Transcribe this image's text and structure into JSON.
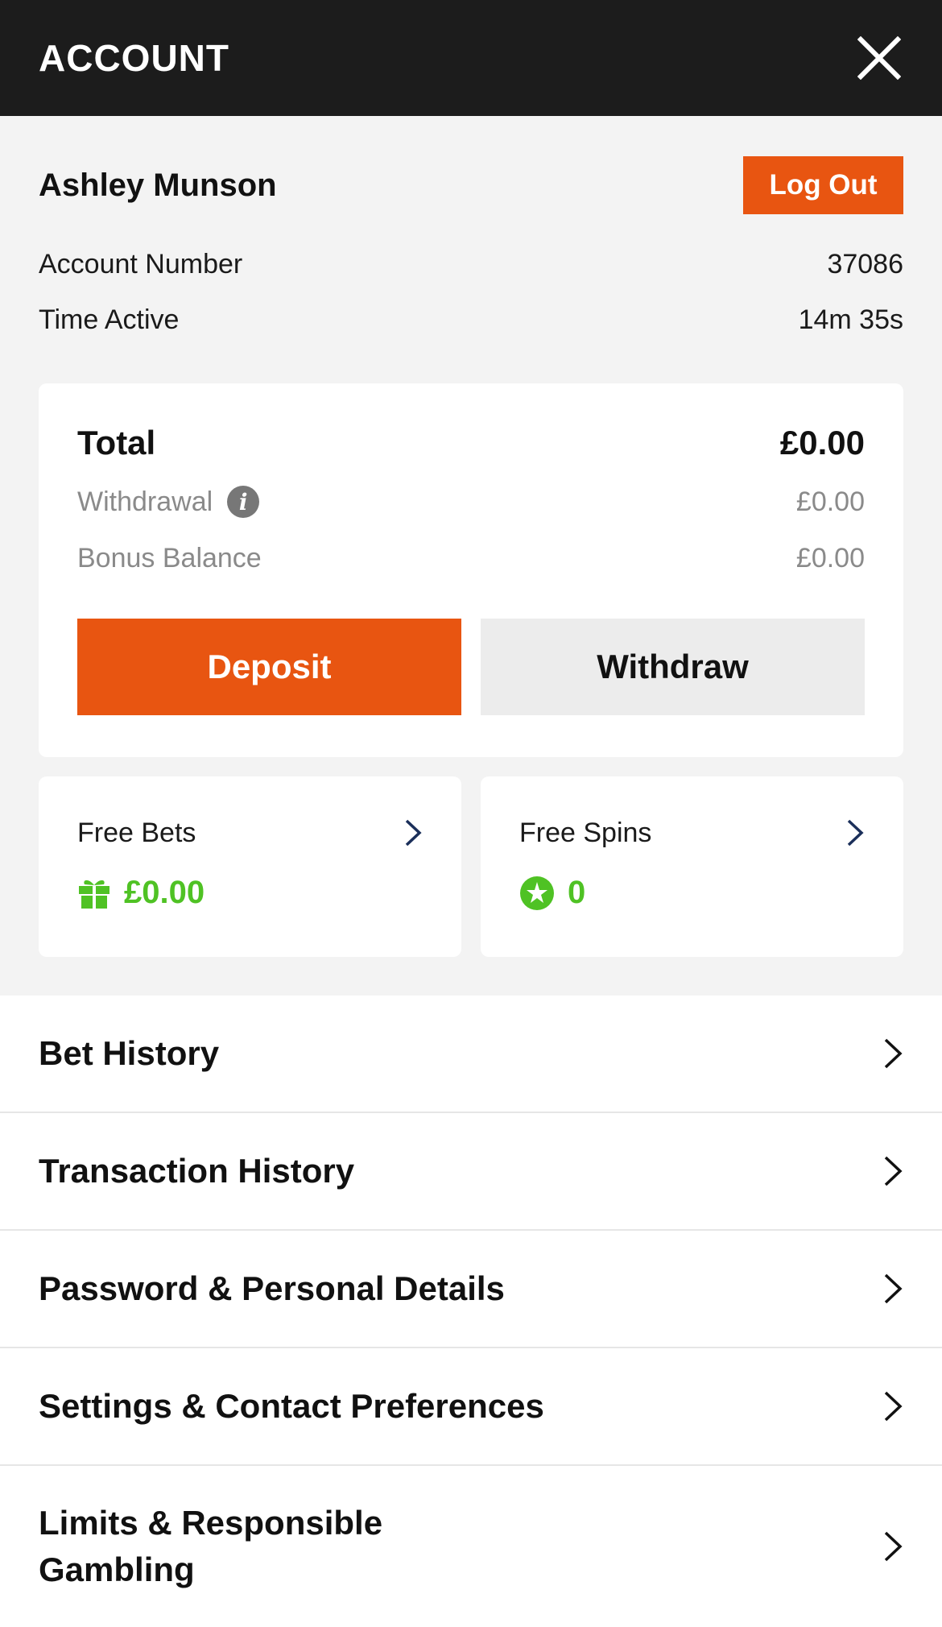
{
  "header": {
    "title": "ACCOUNT"
  },
  "user": {
    "name": "Ashley Munson",
    "logout_label": "Log Out"
  },
  "account_info": [
    {
      "label": "Account Number",
      "value": "37086"
    },
    {
      "label": "Time Active",
      "value": "14m 35s"
    }
  ],
  "balance": {
    "total_label": "Total",
    "total_value": "£0.00",
    "withdrawal_label": "Withdrawal",
    "withdrawal_value": "£0.00",
    "bonus_label": "Bonus Balance",
    "bonus_value": "£0.00",
    "deposit_label": "Deposit",
    "withdraw_label": "Withdraw"
  },
  "promos": {
    "free_bets": {
      "label": "Free Bets",
      "value": "£0.00",
      "icon": "gift-icon"
    },
    "free_spins": {
      "label": "Free Spins",
      "value": "0",
      "icon": "spin-icon"
    }
  },
  "menu": {
    "items": [
      {
        "label": "Bet History"
      },
      {
        "label": "Transaction History"
      },
      {
        "label": "Password & Personal Details"
      },
      {
        "label": "Settings & Contact Preferences"
      },
      {
        "label": "Limits & Responsible Gambling"
      }
    ]
  },
  "colors": {
    "accent": "#e85511",
    "header_bg": "#1c1c1c",
    "promo_green": "#4fc224"
  }
}
